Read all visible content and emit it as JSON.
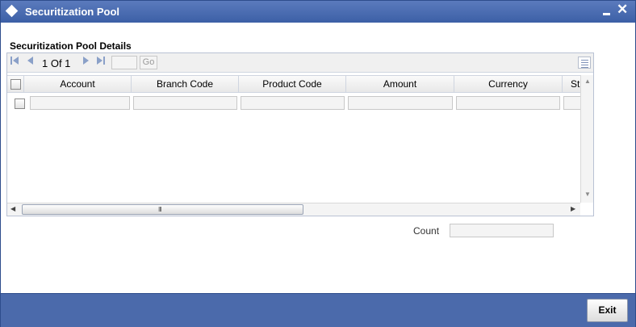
{
  "window": {
    "title": "Securitization Pool",
    "minimize_glyph": "–",
    "close_glyph": "✕"
  },
  "section": {
    "title": "Securitization Pool Details"
  },
  "pager": {
    "page_text": "1 Of 1",
    "go_label": "Go",
    "first_icon": "⏮",
    "prev_icon": "◀",
    "next_icon": "▶",
    "last_icon": "⏭"
  },
  "table": {
    "columns": [
      "Account",
      "Branch Code",
      "Product Code",
      "Amount",
      "Currency",
      "St"
    ],
    "rows": [
      [
        "",
        "",
        "",
        "",
        "",
        ""
      ]
    ]
  },
  "scroll": {
    "grip": "III"
  },
  "count": {
    "label": "Count",
    "value": ""
  },
  "footer": {
    "exit_label": "Exit"
  },
  "colors": {
    "titlebar": "#3c5fa6",
    "footer": "#4b6aab"
  }
}
